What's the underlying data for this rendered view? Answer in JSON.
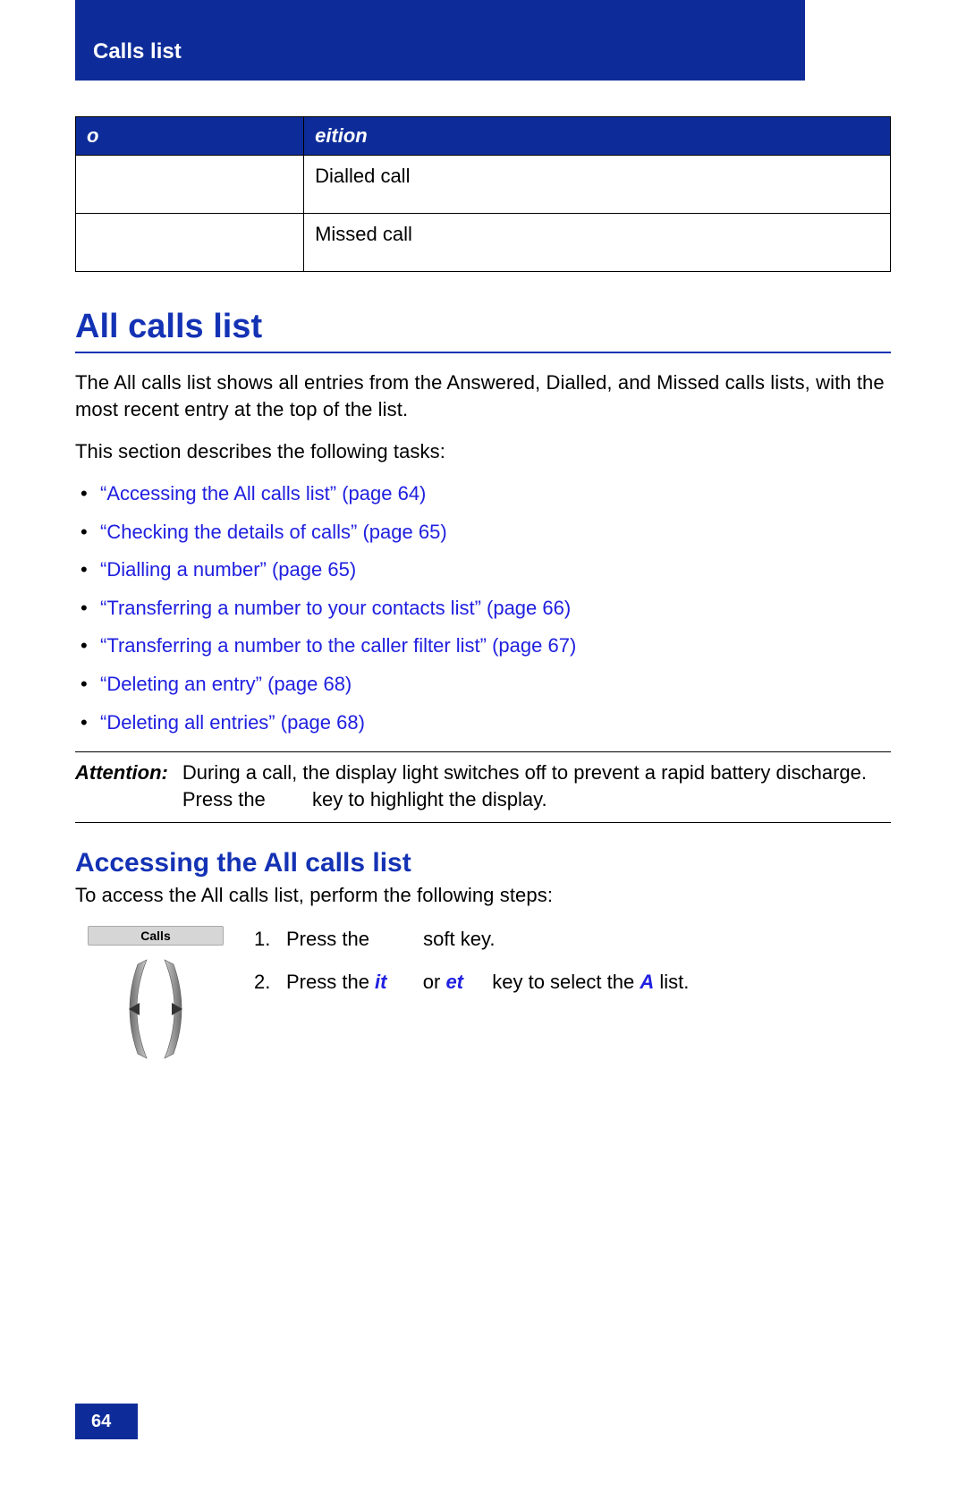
{
  "header": {
    "chapter": "Calls list"
  },
  "table": {
    "col1": "o",
    "col2": "eition",
    "rows": [
      {
        "icon": "",
        "def": "Dialled call"
      },
      {
        "icon": "",
        "def": "Missed call"
      }
    ]
  },
  "section_title": "All calls list",
  "intro1": "The All calls list shows all entries from the Answered, Dialled, and Missed calls lists, with the most recent entry at the top of the list.",
  "intro2": "This section describes the following tasks:",
  "links": [
    "“Accessing the All calls list” (page 64)",
    "“Checking the details of calls” (page 65)",
    "“Dialling a number” (page 65)",
    "“Transferring a number to your contacts list” (page 66)",
    "“Transferring a number to the caller filter list” (page 67)",
    "“Deleting an entry” (page 68)",
    "“Deleting all entries” (page 68)"
  ],
  "attention": {
    "label": "Attention:",
    "text_a": "During a call, the display light switches off to prevent a rapid battery discharge. Press the ",
    "text_b": " key to highlight the display."
  },
  "sub_title": "Accessing the All calls list",
  "sub_intro": "To access the All calls list, perform the following steps:",
  "softkey": "Calls",
  "steps": {
    "s1": {
      "n": "1.",
      "a": "Press the ",
      "b": " soft key."
    },
    "s2": {
      "n": "2.",
      "a": "Press the ",
      "k1": "it",
      "b": " or ",
      "k2": "et",
      "c": " key to select the ",
      "k3": "A",
      "d": " list."
    }
  },
  "page_number": "64"
}
